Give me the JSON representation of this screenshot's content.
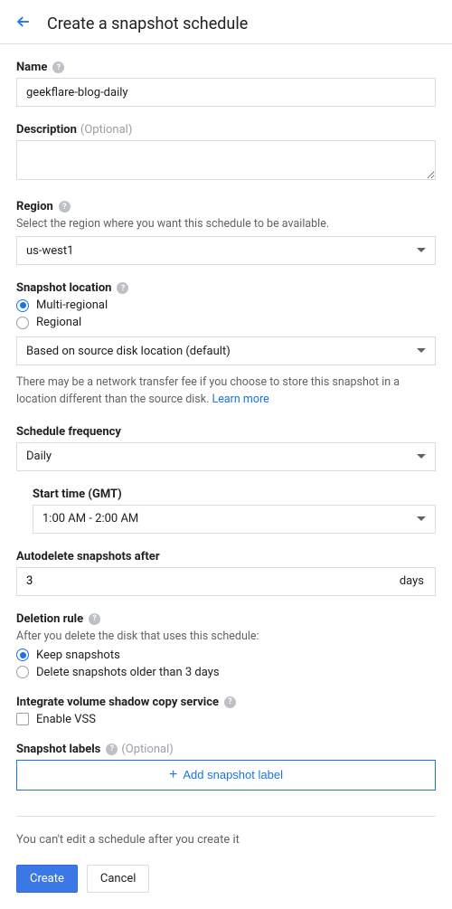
{
  "header": {
    "title": "Create a snapshot schedule"
  },
  "name": {
    "label": "Name",
    "value": "geekflare-blog-daily"
  },
  "description": {
    "label": "Description",
    "optional": "(Optional)",
    "value": ""
  },
  "region": {
    "label": "Region",
    "hint": "Select the region where you want this schedule to be available.",
    "value": "us-west1"
  },
  "snapshotLocation": {
    "label": "Snapshot location",
    "options": {
      "multi": "Multi-regional",
      "regional": "Regional"
    },
    "locationSelectValue": "Based on source disk location (default)",
    "feeHintPre": "There may be a network transfer fee if you choose to store this snapshot in a location different than the source disk. ",
    "feeHintLink": "Learn more"
  },
  "scheduleFrequency": {
    "label": "Schedule frequency",
    "value": "Daily"
  },
  "startTime": {
    "label": "Start time (GMT)",
    "value": "1:00 AM - 2:00 AM"
  },
  "autodelete": {
    "label": "Autodelete snapshots after",
    "value": "3",
    "unit": "days"
  },
  "deletionRule": {
    "label": "Deletion rule",
    "hint": "After you delete the disk that uses this schedule:",
    "options": {
      "keep": "Keep snapshots",
      "deleteOlder": "Delete snapshots older than 3 days"
    }
  },
  "vss": {
    "label": "Integrate volume shadow copy service",
    "checkbox": "Enable VSS"
  },
  "snapshotLabels": {
    "label": "Snapshot labels",
    "optional": "(Optional)",
    "addButton": "Add snapshot label"
  },
  "footnote": "You can't edit a schedule after you create it",
  "buttons": {
    "create": "Create",
    "cancel": "Cancel"
  }
}
